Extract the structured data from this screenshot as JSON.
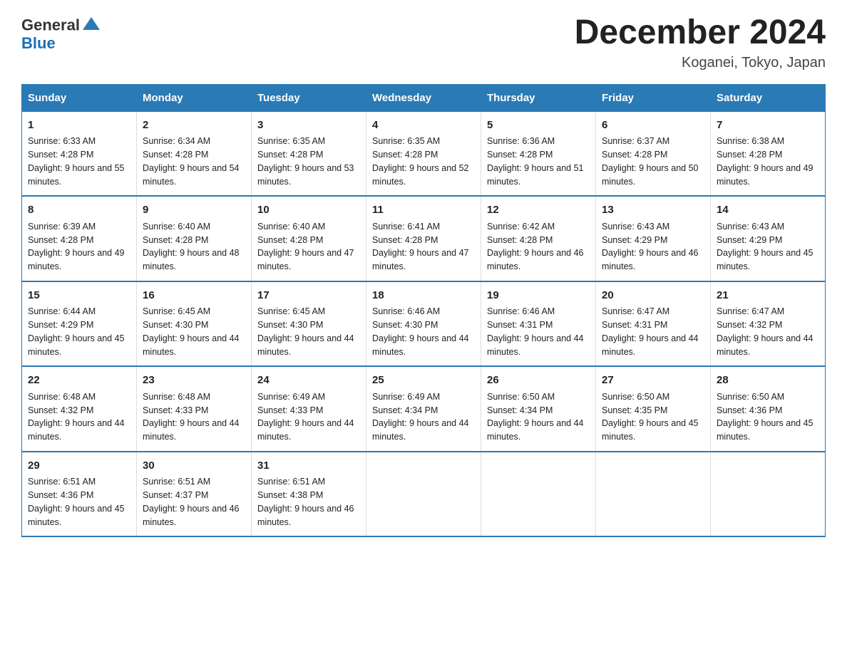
{
  "header": {
    "logo_text_general": "General",
    "logo_text_blue": "Blue",
    "title": "December 2024",
    "subtitle": "Koganei, Tokyo, Japan"
  },
  "days_of_week": [
    "Sunday",
    "Monday",
    "Tuesday",
    "Wednesday",
    "Thursday",
    "Friday",
    "Saturday"
  ],
  "weeks": [
    [
      {
        "day": "1",
        "sunrise": "Sunrise: 6:33 AM",
        "sunset": "Sunset: 4:28 PM",
        "daylight": "Daylight: 9 hours and 55 minutes."
      },
      {
        "day": "2",
        "sunrise": "Sunrise: 6:34 AM",
        "sunset": "Sunset: 4:28 PM",
        "daylight": "Daylight: 9 hours and 54 minutes."
      },
      {
        "day": "3",
        "sunrise": "Sunrise: 6:35 AM",
        "sunset": "Sunset: 4:28 PM",
        "daylight": "Daylight: 9 hours and 53 minutes."
      },
      {
        "day": "4",
        "sunrise": "Sunrise: 6:35 AM",
        "sunset": "Sunset: 4:28 PM",
        "daylight": "Daylight: 9 hours and 52 minutes."
      },
      {
        "day": "5",
        "sunrise": "Sunrise: 6:36 AM",
        "sunset": "Sunset: 4:28 PM",
        "daylight": "Daylight: 9 hours and 51 minutes."
      },
      {
        "day": "6",
        "sunrise": "Sunrise: 6:37 AM",
        "sunset": "Sunset: 4:28 PM",
        "daylight": "Daylight: 9 hours and 50 minutes."
      },
      {
        "day": "7",
        "sunrise": "Sunrise: 6:38 AM",
        "sunset": "Sunset: 4:28 PM",
        "daylight": "Daylight: 9 hours and 49 minutes."
      }
    ],
    [
      {
        "day": "8",
        "sunrise": "Sunrise: 6:39 AM",
        "sunset": "Sunset: 4:28 PM",
        "daylight": "Daylight: 9 hours and 49 minutes."
      },
      {
        "day": "9",
        "sunrise": "Sunrise: 6:40 AM",
        "sunset": "Sunset: 4:28 PM",
        "daylight": "Daylight: 9 hours and 48 minutes."
      },
      {
        "day": "10",
        "sunrise": "Sunrise: 6:40 AM",
        "sunset": "Sunset: 4:28 PM",
        "daylight": "Daylight: 9 hours and 47 minutes."
      },
      {
        "day": "11",
        "sunrise": "Sunrise: 6:41 AM",
        "sunset": "Sunset: 4:28 PM",
        "daylight": "Daylight: 9 hours and 47 minutes."
      },
      {
        "day": "12",
        "sunrise": "Sunrise: 6:42 AM",
        "sunset": "Sunset: 4:28 PM",
        "daylight": "Daylight: 9 hours and 46 minutes."
      },
      {
        "day": "13",
        "sunrise": "Sunrise: 6:43 AM",
        "sunset": "Sunset: 4:29 PM",
        "daylight": "Daylight: 9 hours and 46 minutes."
      },
      {
        "day": "14",
        "sunrise": "Sunrise: 6:43 AM",
        "sunset": "Sunset: 4:29 PM",
        "daylight": "Daylight: 9 hours and 45 minutes."
      }
    ],
    [
      {
        "day": "15",
        "sunrise": "Sunrise: 6:44 AM",
        "sunset": "Sunset: 4:29 PM",
        "daylight": "Daylight: 9 hours and 45 minutes."
      },
      {
        "day": "16",
        "sunrise": "Sunrise: 6:45 AM",
        "sunset": "Sunset: 4:30 PM",
        "daylight": "Daylight: 9 hours and 44 minutes."
      },
      {
        "day": "17",
        "sunrise": "Sunrise: 6:45 AM",
        "sunset": "Sunset: 4:30 PM",
        "daylight": "Daylight: 9 hours and 44 minutes."
      },
      {
        "day": "18",
        "sunrise": "Sunrise: 6:46 AM",
        "sunset": "Sunset: 4:30 PM",
        "daylight": "Daylight: 9 hours and 44 minutes."
      },
      {
        "day": "19",
        "sunrise": "Sunrise: 6:46 AM",
        "sunset": "Sunset: 4:31 PM",
        "daylight": "Daylight: 9 hours and 44 minutes."
      },
      {
        "day": "20",
        "sunrise": "Sunrise: 6:47 AM",
        "sunset": "Sunset: 4:31 PM",
        "daylight": "Daylight: 9 hours and 44 minutes."
      },
      {
        "day": "21",
        "sunrise": "Sunrise: 6:47 AM",
        "sunset": "Sunset: 4:32 PM",
        "daylight": "Daylight: 9 hours and 44 minutes."
      }
    ],
    [
      {
        "day": "22",
        "sunrise": "Sunrise: 6:48 AM",
        "sunset": "Sunset: 4:32 PM",
        "daylight": "Daylight: 9 hours and 44 minutes."
      },
      {
        "day": "23",
        "sunrise": "Sunrise: 6:48 AM",
        "sunset": "Sunset: 4:33 PM",
        "daylight": "Daylight: 9 hours and 44 minutes."
      },
      {
        "day": "24",
        "sunrise": "Sunrise: 6:49 AM",
        "sunset": "Sunset: 4:33 PM",
        "daylight": "Daylight: 9 hours and 44 minutes."
      },
      {
        "day": "25",
        "sunrise": "Sunrise: 6:49 AM",
        "sunset": "Sunset: 4:34 PM",
        "daylight": "Daylight: 9 hours and 44 minutes."
      },
      {
        "day": "26",
        "sunrise": "Sunrise: 6:50 AM",
        "sunset": "Sunset: 4:34 PM",
        "daylight": "Daylight: 9 hours and 44 minutes."
      },
      {
        "day": "27",
        "sunrise": "Sunrise: 6:50 AM",
        "sunset": "Sunset: 4:35 PM",
        "daylight": "Daylight: 9 hours and 45 minutes."
      },
      {
        "day": "28",
        "sunrise": "Sunrise: 6:50 AM",
        "sunset": "Sunset: 4:36 PM",
        "daylight": "Daylight: 9 hours and 45 minutes."
      }
    ],
    [
      {
        "day": "29",
        "sunrise": "Sunrise: 6:51 AM",
        "sunset": "Sunset: 4:36 PM",
        "daylight": "Daylight: 9 hours and 45 minutes."
      },
      {
        "day": "30",
        "sunrise": "Sunrise: 6:51 AM",
        "sunset": "Sunset: 4:37 PM",
        "daylight": "Daylight: 9 hours and 46 minutes."
      },
      {
        "day": "31",
        "sunrise": "Sunrise: 6:51 AM",
        "sunset": "Sunset: 4:38 PM",
        "daylight": "Daylight: 9 hours and 46 minutes."
      },
      {
        "day": "",
        "sunrise": "",
        "sunset": "",
        "daylight": ""
      },
      {
        "day": "",
        "sunrise": "",
        "sunset": "",
        "daylight": ""
      },
      {
        "day": "",
        "sunrise": "",
        "sunset": "",
        "daylight": ""
      },
      {
        "day": "",
        "sunrise": "",
        "sunset": "",
        "daylight": ""
      }
    ]
  ]
}
